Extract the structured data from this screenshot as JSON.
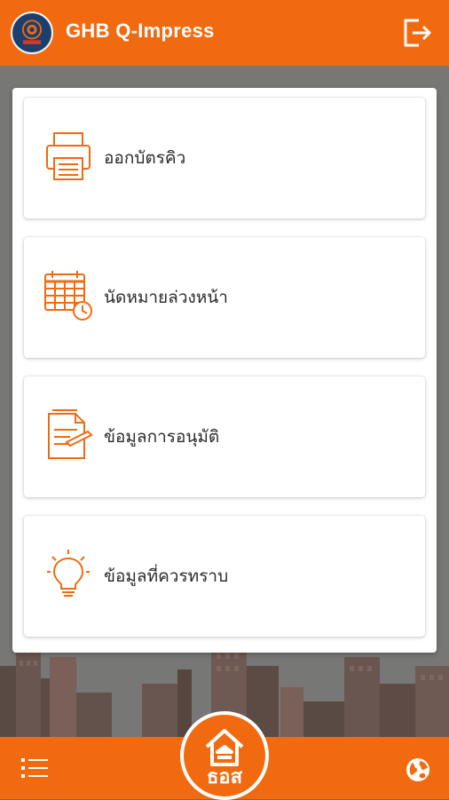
{
  "app": {
    "title": "GHB Q-Impress",
    "logo_icon": "ghb-logo-icon",
    "logout_icon": "logout-icon"
  },
  "colors": {
    "primary": "#f26a10",
    "background": "#777776",
    "card": "#ffffff",
    "text": "#2a2a2a"
  },
  "menu": {
    "items": [
      {
        "label": "ออกบัตรคิว",
        "icon": "printer-icon"
      },
      {
        "label": "นัดหมายล่วงหน้า",
        "icon": "calendar-clock-icon"
      },
      {
        "label": "ข้อมูลการอนุมัติ",
        "icon": "document-pen-icon"
      },
      {
        "label": "ข้อมูลที่ควรทราบ",
        "icon": "lightbulb-icon"
      }
    ]
  },
  "bottom_bar": {
    "menu_icon": "list-menu-icon",
    "center_label": "ธอส",
    "center_icon": "ghb-home-icon",
    "globe_icon": "globe-icon"
  }
}
